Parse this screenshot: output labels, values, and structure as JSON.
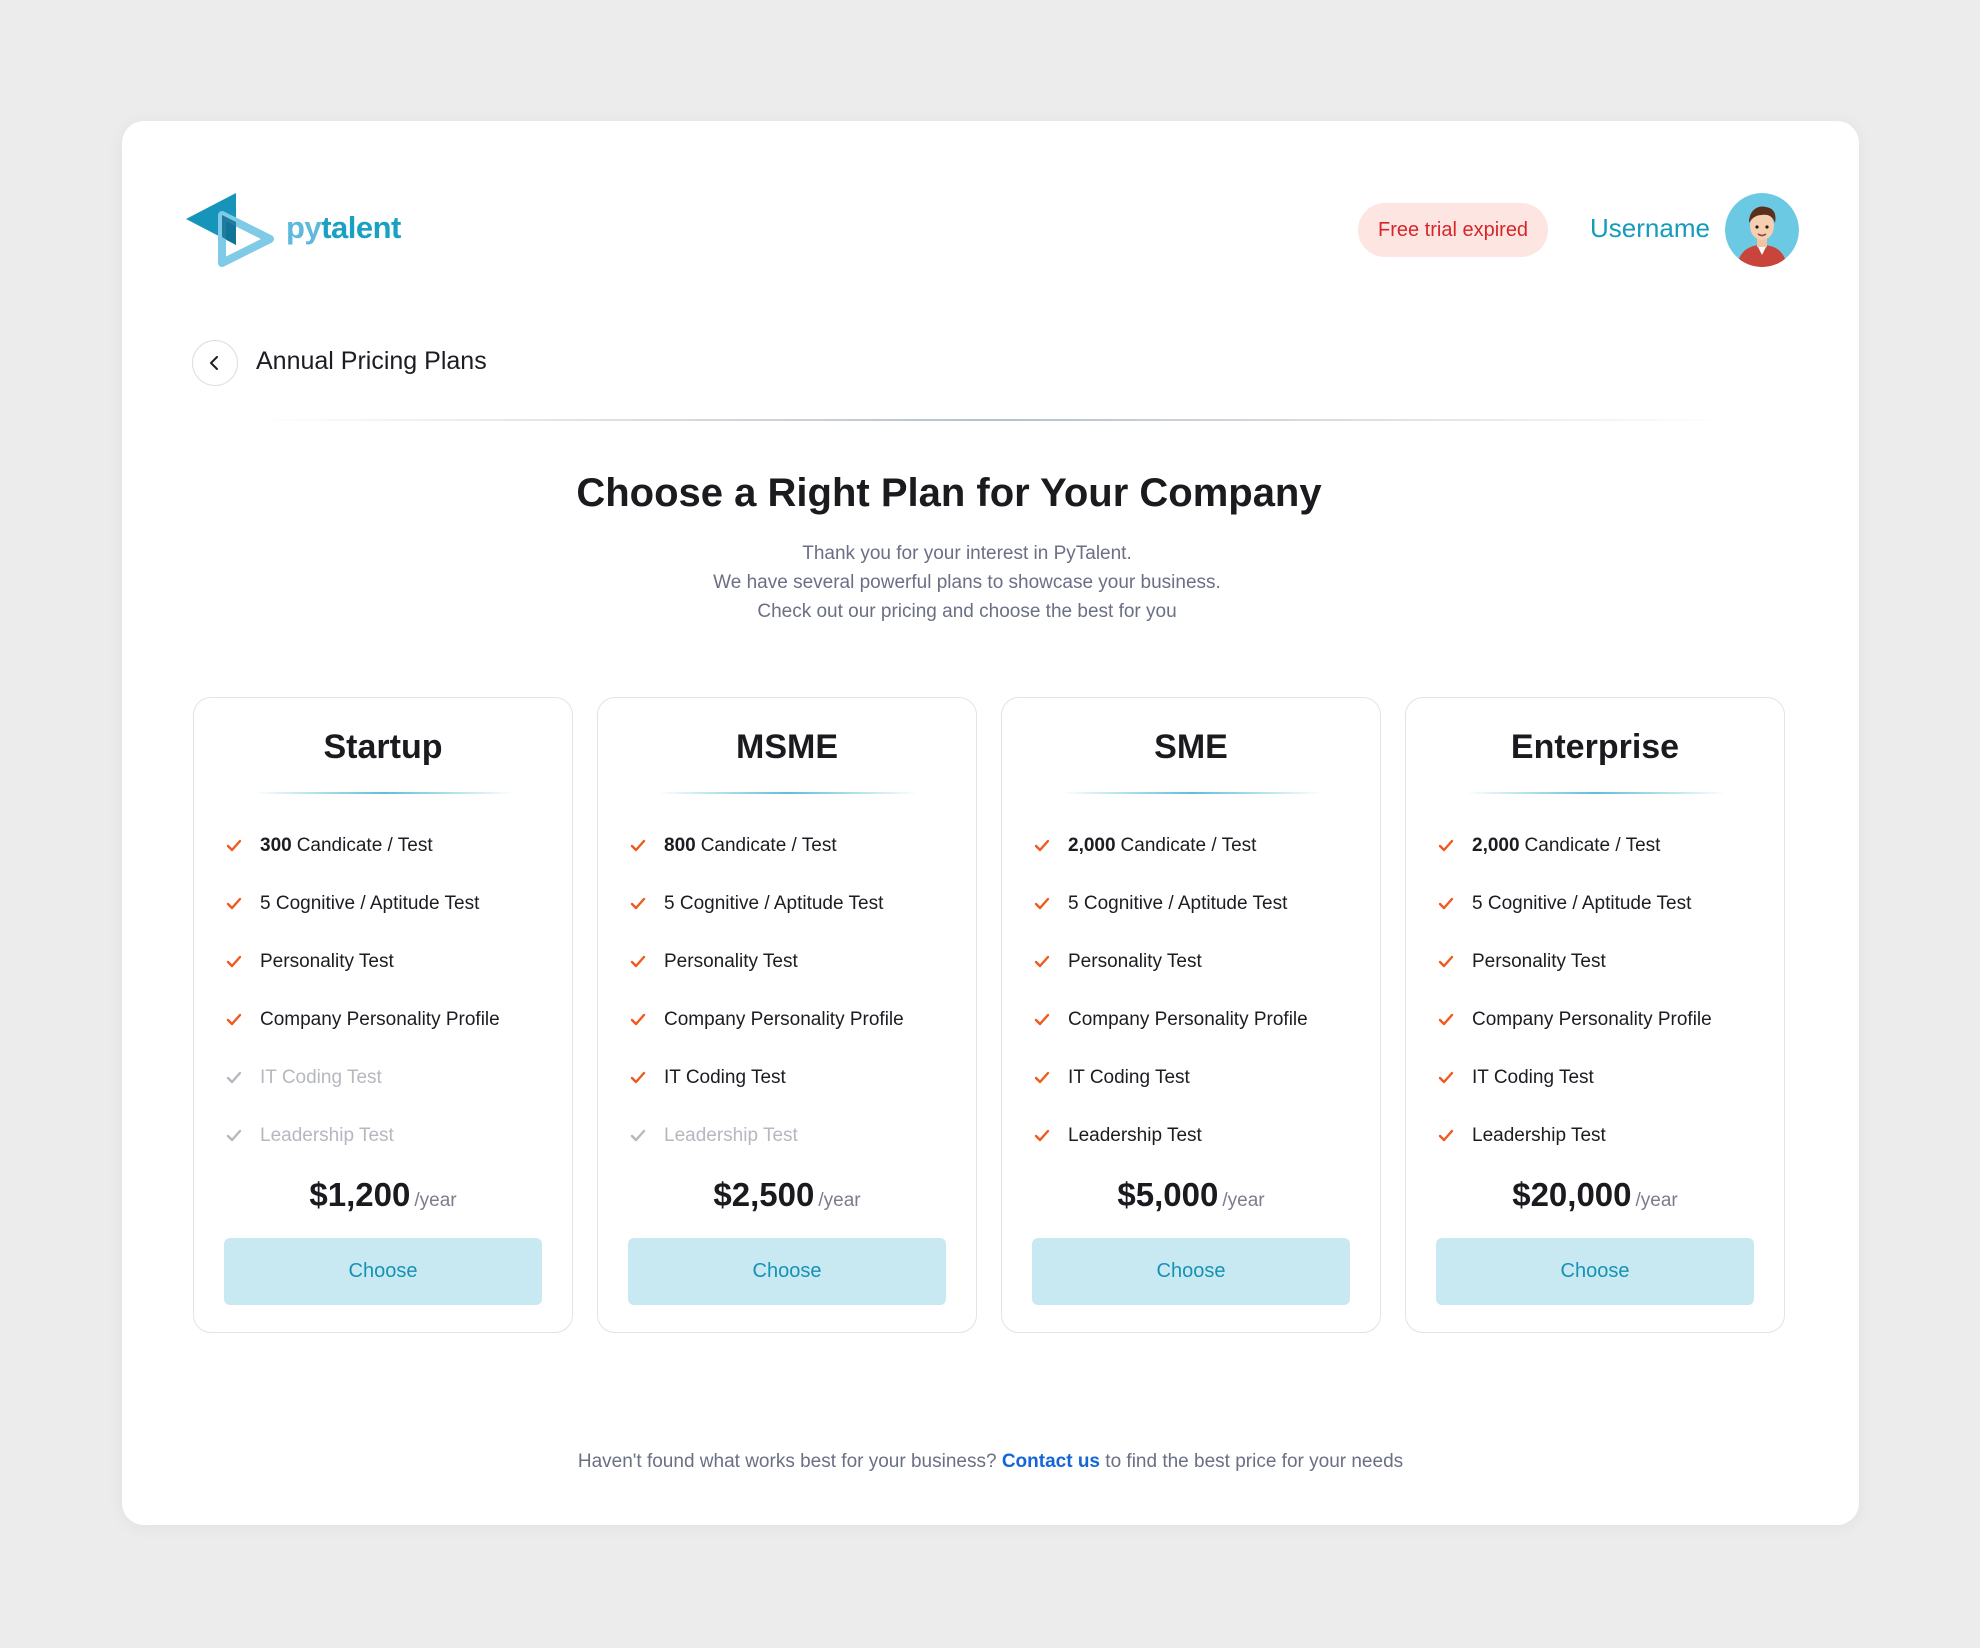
{
  "brand": {
    "name_prefix": "py",
    "name_suffix": "talent"
  },
  "header": {
    "trial_badge": "Free trial expired",
    "username": "Username"
  },
  "page": {
    "title": "Annual Pricing Plans"
  },
  "hero": {
    "title": "Choose a Right Plan for Your Company",
    "lines": [
      "Thank you for your interest in PyTalent.",
      "We have several powerful plans to showcase your business.",
      "Check out our pricing and choose the best for you"
    ]
  },
  "plans": [
    {
      "name": "Startup",
      "features": [
        {
          "bold": "300",
          "text": "Candicate / Test",
          "included": true
        },
        {
          "bold": "",
          "text": "5 Cognitive / Aptitude Test",
          "included": true
        },
        {
          "bold": "",
          "text": "Personality Test",
          "included": true
        },
        {
          "bold": "",
          "text": "Company Personality Profile",
          "included": true
        },
        {
          "bold": "",
          "text": "IT Coding Test",
          "included": false
        },
        {
          "bold": "",
          "text": "Leadership Test",
          "included": false
        }
      ],
      "price": "$1,200",
      "period": "/year",
      "cta": "Choose"
    },
    {
      "name": "MSME",
      "features": [
        {
          "bold": "800",
          "text": "Candicate / Test",
          "included": true
        },
        {
          "bold": "",
          "text": "5 Cognitive / Aptitude Test",
          "included": true
        },
        {
          "bold": "",
          "text": "Personality Test",
          "included": true
        },
        {
          "bold": "",
          "text": "Company Personality Profile",
          "included": true
        },
        {
          "bold": "",
          "text": "IT Coding Test",
          "included": true
        },
        {
          "bold": "",
          "text": "Leadership Test",
          "included": false
        }
      ],
      "price": "$2,500",
      "period": "/year",
      "cta": "Choose"
    },
    {
      "name": "SME",
      "features": [
        {
          "bold": "2,000",
          "text": "Candicate / Test",
          "included": true
        },
        {
          "bold": "",
          "text": "5 Cognitive / Aptitude Test",
          "included": true
        },
        {
          "bold": "",
          "text": "Personality Test",
          "included": true
        },
        {
          "bold": "",
          "text": "Company Personality Profile",
          "included": true
        },
        {
          "bold": "",
          "text": "IT Coding Test",
          "included": true
        },
        {
          "bold": "",
          "text": "Leadership Test",
          "included": true
        }
      ],
      "price": "$5,000",
      "period": "/year",
      "cta": "Choose"
    },
    {
      "name": "Enterprise",
      "features": [
        {
          "bold": "2,000",
          "text": "Candicate / Test",
          "included": true
        },
        {
          "bold": "",
          "text": "5 Cognitive / Aptitude Test",
          "included": true
        },
        {
          "bold": "",
          "text": "Personality Test",
          "included": true
        },
        {
          "bold": "",
          "text": "Company Personality Profile",
          "included": true
        },
        {
          "bold": "",
          "text": "IT Coding Test",
          "included": true
        },
        {
          "bold": "",
          "text": "Leadership Test",
          "included": true
        }
      ],
      "price": "$20,000",
      "period": "/year",
      "cta": "Choose"
    }
  ],
  "footer": {
    "before": "Haven't found what works best for your business?",
    "link": "Contact us",
    "after": "to find the best price for your needs"
  },
  "colors": {
    "accent": "#149bbd",
    "check_on": "#f05a1e",
    "check_off": "#b6b8bf",
    "button_bg": "#c9e9f2",
    "badge_bg": "#fde6e1",
    "badge_text": "#d7262a",
    "link": "#1466d6"
  },
  "icons": {
    "logo": "play-triangle-logo",
    "back": "chevron-left-icon",
    "check": "check-icon",
    "avatar": "user-avatar"
  }
}
